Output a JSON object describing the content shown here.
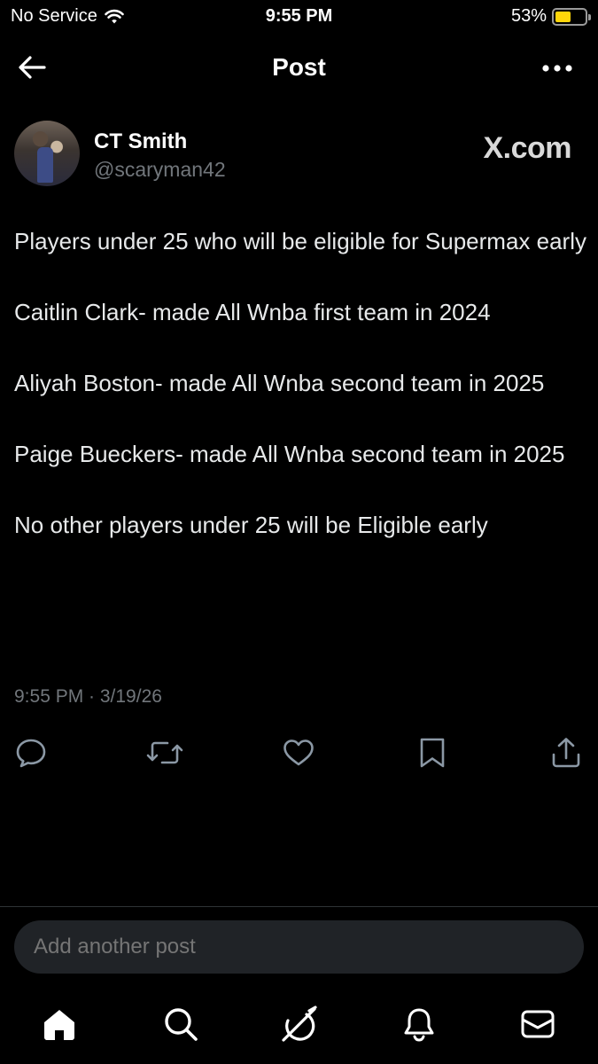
{
  "status_bar": {
    "carrier": "No Service",
    "time": "9:55 PM",
    "battery_percent": "53%",
    "battery_level": 0.53,
    "battery_color": "#ffd60a"
  },
  "nav": {
    "title": "Post",
    "back_icon": "arrow-left-icon",
    "more_icon": "more-horizontal-icon"
  },
  "post": {
    "author_name": "CT Smith",
    "author_handle": "@scaryman42",
    "brand": "X.com",
    "paragraphs": [
      "Players under 25 who will be eligible for Supermax early",
      "Caitlin Clark- made All Wnba first team in 2024",
      "Aliyah Boston- made All Wnba second team in 2025",
      "Paige Bueckers- made All Wnba second team in 2025",
      "No other players under 25 will be Eligible early"
    ],
    "timestamp": "9:55 PM · 3/19/26"
  },
  "actions": [
    "reply-icon",
    "repost-icon",
    "like-icon",
    "bookmark-icon",
    "share-icon"
  ],
  "reply": {
    "placeholder": "Add another post"
  },
  "tab_bar": [
    "home-icon",
    "search-icon",
    "grok-icon",
    "notifications-icon",
    "messages-icon"
  ]
}
